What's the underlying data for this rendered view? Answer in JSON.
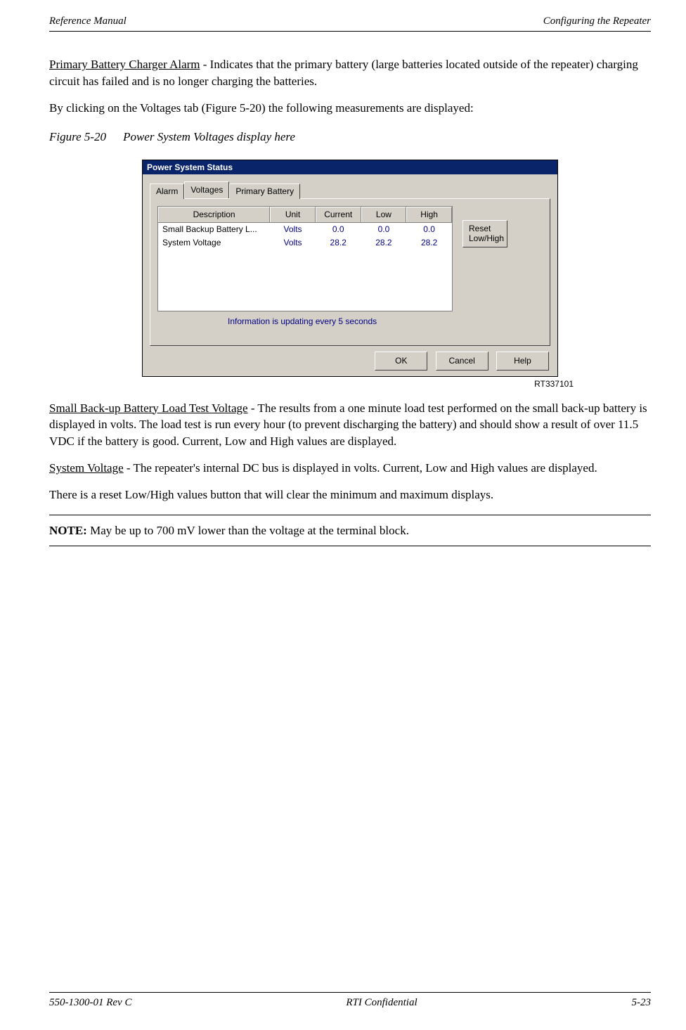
{
  "header": {
    "left": "Reference Manual",
    "right": "Configuring the Repeater"
  },
  "paragraphs": {
    "p1_label": "Primary Battery Charger Alarm",
    "p1_rest": " - Indicates that the primary battery (large batteries located outside of the repeater) charging circuit has failed and is no longer charging the batteries.",
    "p2": "By clicking on the Voltages tab (Figure 5-20) the following measurements are displayed:",
    "p3_label": "Small Back-up Battery Load Test Voltage",
    "p3_rest": " - The results from a one minute load test performed on the small back-up battery is displayed in volts. The load test is run every hour (to prevent discharging the battery) and should show a result of over 11.5 VDC if the battery is good. Current, Low and High values are displayed.",
    "p4_label": "System Voltage",
    "p4_rest": " - The repeater's internal DC bus is displayed in volts. Current, Low and High values are displayed.",
    "p5": "There is a reset Low/High values button that will clear the minimum and maximum displays."
  },
  "figure": {
    "num": "Figure 5-20",
    "caption": "Power System Voltages display here",
    "id": "RT337101"
  },
  "dialog": {
    "title": "Power System Status",
    "tabs": {
      "alarm": "Alarm",
      "voltages": "Voltages",
      "battery": "Primary Battery"
    },
    "columns": {
      "desc": "Description",
      "unit": "Unit",
      "current": "Current",
      "low": "Low",
      "high": "High"
    },
    "rows": [
      {
        "desc": "Small Backup Battery L...",
        "unit": "Volts",
        "current": "0.0",
        "low": "0.0",
        "high": "0.0"
      },
      {
        "desc": "System Voltage",
        "unit": "Volts",
        "current": "28.2",
        "low": "28.2",
        "high": "28.2"
      }
    ],
    "reset": "Reset Low/High",
    "info": "Information is updating every 5 seconds",
    "ok": "OK",
    "cancel": "Cancel",
    "help": "Help"
  },
  "note": {
    "label": "NOTE:",
    "text": "  May be up to 700 mV lower than the voltage at the terminal block."
  },
  "footer": {
    "left": "550-1300-01 Rev C",
    "center": "RTI Confidential",
    "right": "5-23"
  }
}
